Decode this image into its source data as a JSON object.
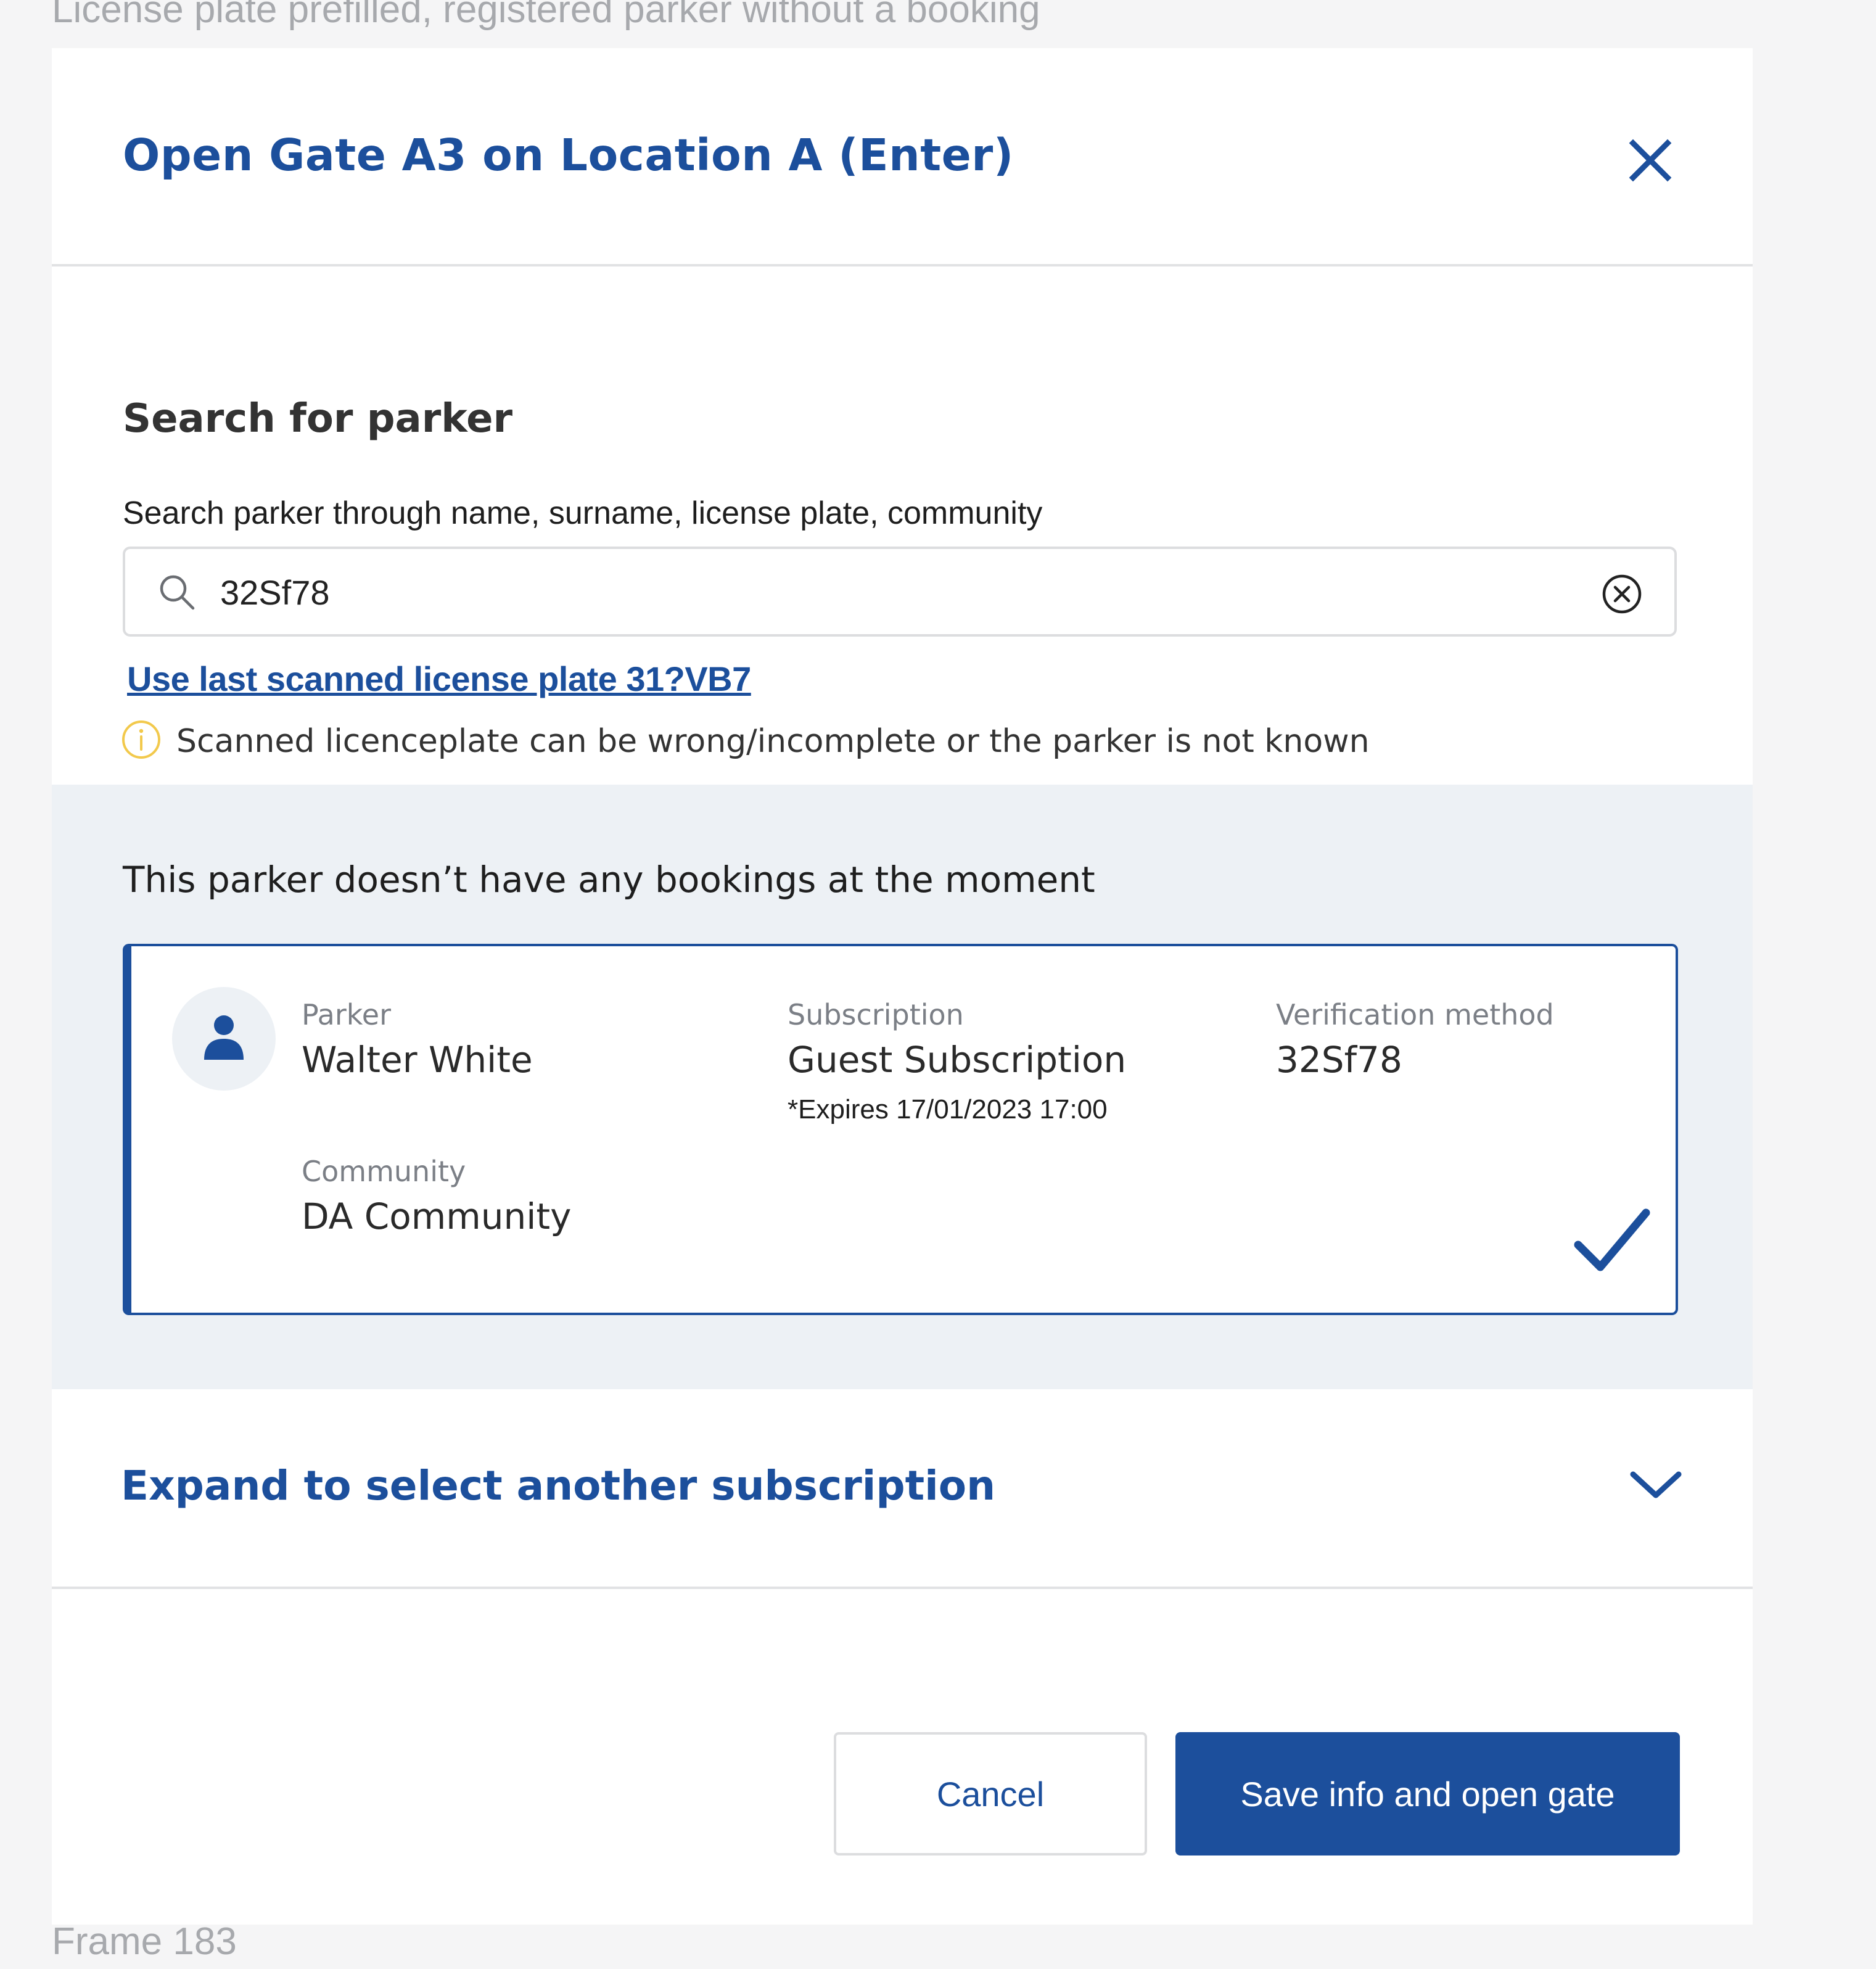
{
  "canvas": {
    "caption_top": "License plate prefilled, registered parker without a booking",
    "caption_bottom": "Frame 183"
  },
  "modal": {
    "title": "Open Gate A3 on Location A (Enter)",
    "close_icon": "close-icon",
    "search": {
      "title": "Search for parker",
      "hint": "Search parker through name, surname, license plate, community",
      "value": "32Sf78",
      "search_icon": "search-icon",
      "clear_icon": "clear-icon",
      "scan_link": "Use last scanned license plate  31?VB7",
      "warning_icon": "info-icon",
      "warning_text": "Scanned licenceplate can be wrong/incomplete or the parker is not known"
    },
    "bookings": {
      "message": "This parker doesn’t have any bookings at the moment",
      "card": {
        "avatar_icon": "person-icon",
        "parker_label": "Parker",
        "parker_value": "Walter White",
        "subscription_label": "Subscription",
        "subscription_value": "Guest Subscription",
        "subscription_note": "*Expires 17/01/2023 17:00",
        "verification_label": "Verification method",
        "verification_value": "32Sf78",
        "community_label": "Community",
        "community_value": "DA Community",
        "selected_icon": "checkmark-icon"
      }
    },
    "expand": {
      "label": "Expand to select another subscription",
      "icon": "chevron-down-icon"
    },
    "actions": {
      "cancel": "Cancel",
      "primary": "Save info and open gate"
    }
  },
  "colors": {
    "accent": "#1c4f9c",
    "section_bg": "#edf1f5",
    "warning": "#f2c94c",
    "canvas_bg": "#f5f5f6"
  }
}
